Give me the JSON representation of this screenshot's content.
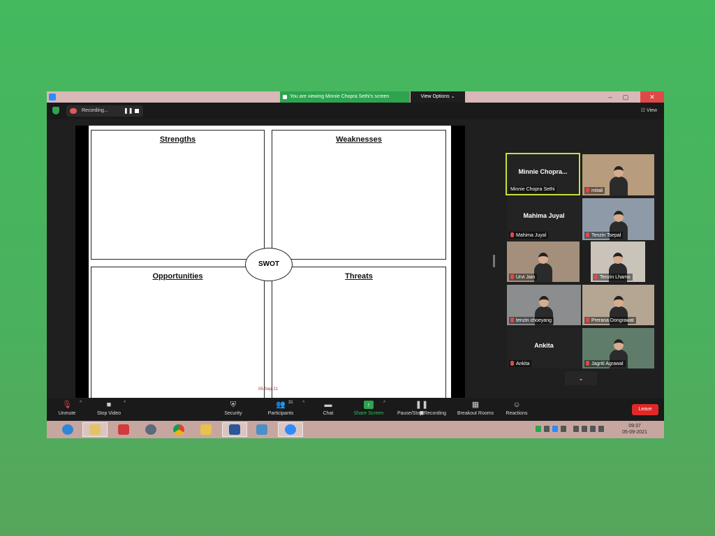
{
  "window": {
    "viewing_banner": "You are viewing Minnie Chopra Sethi's screen",
    "view_options": "View Options ⌄",
    "win_min": "–",
    "win_max": "▢",
    "win_close": "✕"
  },
  "topbar": {
    "recording_label": "Recording...",
    "pause_glyph": "❚❚",
    "view_label": "☷ View"
  },
  "slide": {
    "strengths": "Strengths",
    "weaknesses": "Weaknesses",
    "opportunities": "Opportunities",
    "threats": "Threats",
    "center": "SWOT",
    "date": "05-Sep-21"
  },
  "gallery": [
    {
      "name": "Minnie Chopra...",
      "label": "Minnie Chopra Sethi",
      "video": false,
      "active": true,
      "muted": false
    },
    {
      "name": "",
      "label": "mitali",
      "video": true,
      "active": false,
      "muted": true
    },
    {
      "name": "Mahima Juyal",
      "label": "Mahima Juyal",
      "video": false,
      "active": false,
      "muted": true
    },
    {
      "name": "",
      "label": "Tenzin Tsepal",
      "video": true,
      "active": false,
      "muted": true
    },
    {
      "name": "",
      "label": "Urvi Jain",
      "video": true,
      "active": false,
      "muted": true
    },
    {
      "name": "",
      "label": "Tenzin Lhamo",
      "video": true,
      "active": false,
      "muted": true
    },
    {
      "name": "",
      "label": "tenzin choeyang",
      "video": true,
      "active": false,
      "muted": true
    },
    {
      "name": "",
      "label": "Prerana Dongrawat",
      "video": true,
      "active": false,
      "muted": true
    },
    {
      "name": "Ankita",
      "label": "Ankita",
      "video": false,
      "active": false,
      "muted": true
    },
    {
      "name": "",
      "label": "Jagriti Agrawal",
      "video": true,
      "active": false,
      "muted": true
    }
  ],
  "more_glyph": "⌄",
  "toolbar": {
    "unmute": "Unmute",
    "stop_video": "Stop Video",
    "security": "Security",
    "participants": "Participants",
    "participants_count": "31",
    "chat": "Chat",
    "share_screen": "Share Screen",
    "pause_stop": "Pause/Stop Recording",
    "breakout": "Breakout Rooms",
    "reactions": "Reactions",
    "leave": "Leave",
    "caret": "^"
  },
  "taskbar": {
    "time": "09:37",
    "date": "05-09-2021"
  },
  "colors": {
    "accent_green": "#2ea44f",
    "leave_red": "#e02828",
    "active_speaker_border": "#c6e03a"
  }
}
